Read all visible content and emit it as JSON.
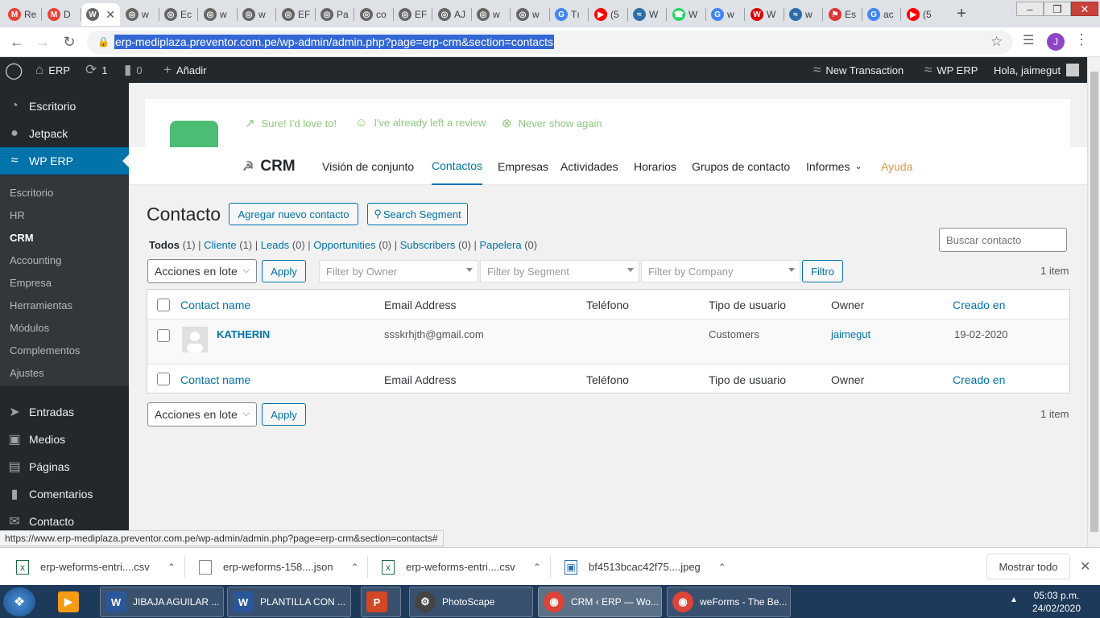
{
  "browser": {
    "tabs": [
      {
        "label": "Re",
        "icon": "gmail-icon",
        "color": "#ea4335",
        "glyph": "M"
      },
      {
        "label": "D",
        "icon": "gmail-icon",
        "color": "#ea4335",
        "glyph": "M"
      },
      {
        "label": "",
        "icon": "wordpress-icon",
        "color": "#666",
        "glyph": "W",
        "active": true
      },
      {
        "label": "w",
        "icon": "globe-icon",
        "color": "#666",
        "glyph": "◎"
      },
      {
        "label": "Ec",
        "icon": "globe-icon",
        "color": "#666",
        "glyph": "◎"
      },
      {
        "label": "w",
        "icon": "globe-icon",
        "color": "#666",
        "glyph": "◎"
      },
      {
        "label": "w",
        "icon": "globe-icon",
        "color": "#666",
        "glyph": "◎"
      },
      {
        "label": "EF",
        "icon": "globe-icon",
        "color": "#666",
        "glyph": "◎"
      },
      {
        "label": "Pa",
        "icon": "globe-icon",
        "color": "#666",
        "glyph": "◎"
      },
      {
        "label": "co",
        "icon": "globe-icon",
        "color": "#666",
        "glyph": "◎"
      },
      {
        "label": "EF",
        "icon": "globe-icon",
        "color": "#666",
        "glyph": "◎"
      },
      {
        "label": "AJ",
        "icon": "globe-icon",
        "color": "#666",
        "glyph": "◎"
      },
      {
        "label": "w",
        "icon": "globe-icon",
        "color": "#666",
        "glyph": "◎"
      },
      {
        "label": "w",
        "icon": "globe-icon",
        "color": "#666",
        "glyph": "◎"
      },
      {
        "label": "Tı",
        "icon": "google-icon",
        "color": "#4285f4",
        "glyph": "G"
      },
      {
        "label": "(5",
        "icon": "youtube-icon",
        "color": "#ff0000",
        "glyph": "▶"
      },
      {
        "label": "W",
        "icon": "wperp-icon",
        "color": "#2c6fa8",
        "glyph": "≈"
      },
      {
        "label": "W",
        "icon": "whatsapp-icon",
        "color": "#25d366",
        "glyph": "☎"
      },
      {
        "label": "w",
        "icon": "google-icon",
        "color": "#4285f4",
        "glyph": "G"
      },
      {
        "label": "W",
        "icon": "wetv-icon",
        "color": "#d00",
        "glyph": "W"
      },
      {
        "label": "w",
        "icon": "wperp-icon",
        "color": "#2c6fa8",
        "glyph": "≈"
      },
      {
        "label": "Es",
        "icon": "doc-icon",
        "color": "#d33",
        "glyph": "⚑"
      },
      {
        "label": "ac",
        "icon": "google-icon",
        "color": "#4285f4",
        "glyph": "G"
      },
      {
        "label": "(5",
        "icon": "youtube-icon",
        "color": "#ff0000",
        "glyph": "▶"
      }
    ],
    "new_tab": "+",
    "window_controls": [
      "–",
      "❐",
      "✕"
    ],
    "url": "erp-mediplaza.preventor.com.pe/wp-admin/admin.php?page=erp-crm&section=contacts",
    "profile_initial": "J",
    "status_url": "https://www.erp-mediplaza.preventor.com.pe/wp-admin/admin.php?page=erp-crm&section=contacts#"
  },
  "adminbar": {
    "site": "ERP",
    "updates": "1",
    "comments": "0",
    "add_new": "Añadir",
    "new_transaction": "New Transaction",
    "wp_erp": "WP ERP",
    "greeting": "Hola, jaimegut"
  },
  "sidebar": {
    "top_items": [
      "Escritorio",
      "Jetpack",
      "WP ERP"
    ],
    "submenu": [
      "Escritorio",
      "HR",
      "CRM",
      "Accounting",
      "Empresa",
      "Herramientas",
      "Módulos",
      "Complementos",
      "Ajustes"
    ],
    "bottom_items": [
      "Entradas",
      "Medios",
      "Páginas",
      "Comentarios",
      "Contacto"
    ]
  },
  "notice": {
    "links": [
      "Sure! I'd love to!",
      "I've already left a review",
      "Never show again"
    ]
  },
  "erp_nav": {
    "brand": "CRM",
    "items": [
      "Visión de conjunto",
      "Contactos",
      "Empresas",
      "Actividades",
      "Horarios",
      "Grupos de contacto",
      "Informes",
      "Ayuda"
    ],
    "active": "Contactos"
  },
  "page": {
    "title": "Contacto",
    "add_button": "Agregar nuevo contacto",
    "segment_button": "Search Segment",
    "views": [
      {
        "label": "Todos",
        "count": "(1)"
      },
      {
        "label": "Cliente",
        "count": "(1)"
      },
      {
        "label": "Leads",
        "count": "(0)"
      },
      {
        "label": "Opportunities",
        "count": "(0)"
      },
      {
        "label": "Subscribers",
        "count": "(0)"
      },
      {
        "label": "Papelera",
        "count": "(0)"
      }
    ],
    "search_placeholder": "Buscar contacto",
    "bulk_actions": "Acciones en lote",
    "apply": "Apply",
    "filters": [
      "Filter by Owner",
      "Filter by Segment",
      "Filter by Company"
    ],
    "filter_button": "Filtro",
    "item_count": "1 item"
  },
  "table": {
    "columns": [
      "Contact name",
      "Email Address",
      "Teléfono",
      "Tipo de usuario",
      "Owner",
      "Creado en"
    ],
    "rows": [
      {
        "name": "KATHERIN",
        "email": "ssskrhjth@gmail.com",
        "phone": "",
        "type": "Customers",
        "owner": "jaimegut",
        "created": "19-02-2020"
      }
    ]
  },
  "downloads": {
    "items": [
      {
        "name": "erp-weforms-entri....csv",
        "icon": "excel-file-icon"
      },
      {
        "name": "erp-weforms-158....json",
        "icon": "file-icon"
      },
      {
        "name": "erp-weforms-entri....csv",
        "icon": "excel-file-icon"
      },
      {
        "name": "bf4513bcac42f75....jpeg",
        "icon": "image-file-icon"
      }
    ],
    "show_all": "Mostrar todo"
  },
  "taskbar": {
    "items": [
      {
        "label": "",
        "icon": "windows-media-player-icon"
      },
      {
        "label": "JIBAJA AGUILAR ...",
        "icon": "word-icon"
      },
      {
        "label": "PLANTILLA CON ...",
        "icon": "word-icon"
      },
      {
        "label": "",
        "icon": "powerpoint-icon"
      },
      {
        "label": "PhotoScape",
        "icon": "photoscape-icon"
      },
      {
        "label": "CRM ‹ ERP — Wo...",
        "icon": "chrome-icon"
      },
      {
        "label": "weForms - The Be...",
        "icon": "chrome-icon"
      }
    ],
    "time": "05:03 p.m.",
    "date": "24/02/2020"
  },
  "colors": {
    "wp_blue": "#0073aa",
    "admin_dark": "#23282d",
    "notice_green": "#8cc97b",
    "taskbar": "#1e3a5a"
  }
}
